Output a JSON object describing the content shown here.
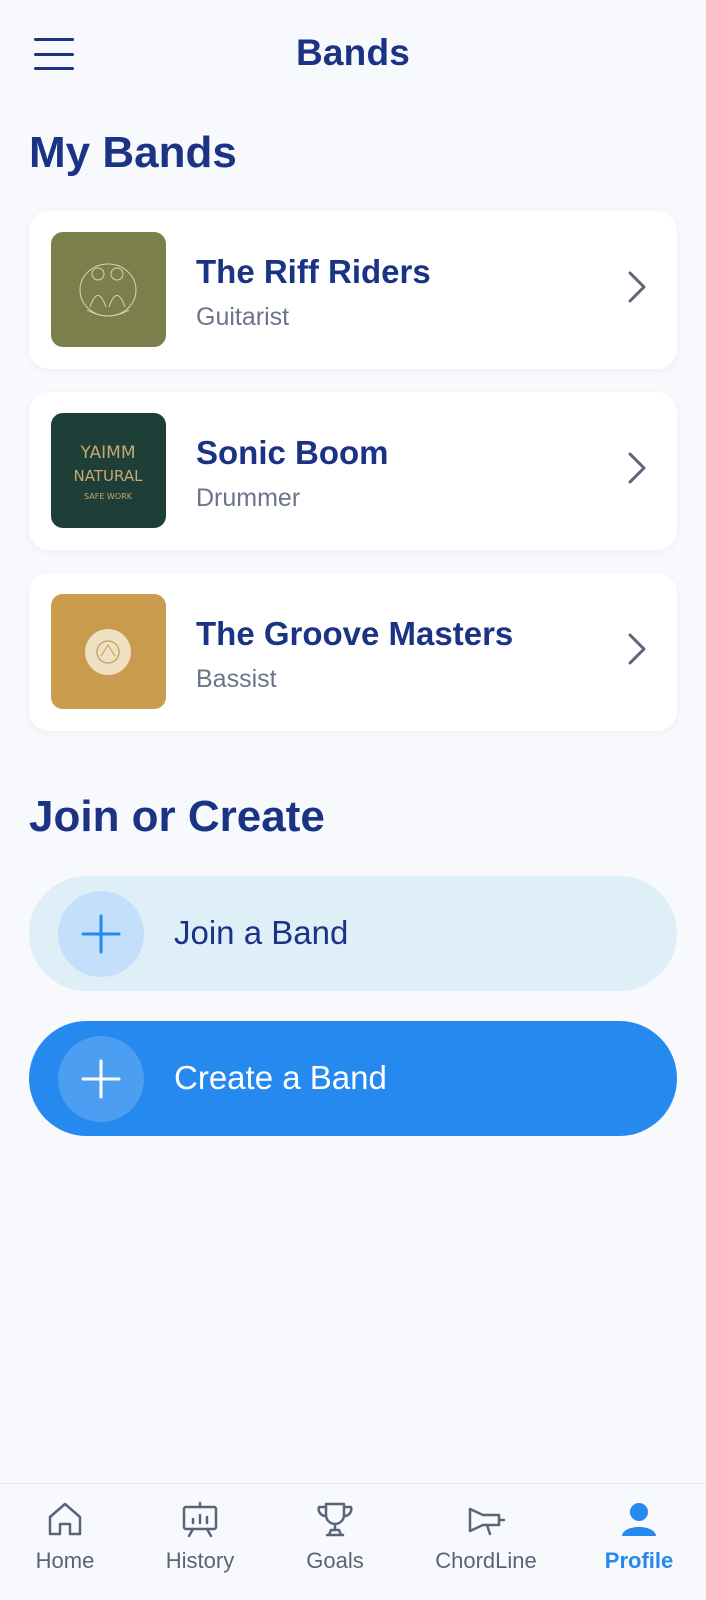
{
  "header": {
    "title": "Bands",
    "menu_icon": "hamburger-menu-icon"
  },
  "my_bands": {
    "heading": "My Bands",
    "items": [
      {
        "name": "The Riff Riders",
        "role": "Guitarist",
        "thumb_color": "#7b7f4b"
      },
      {
        "name": "Sonic Boom",
        "role": "Drummer",
        "thumb_color": "#1d3f38",
        "thumb_text": [
          "YAIMM",
          "NATURAL",
          "SAFE WORK"
        ]
      },
      {
        "name": "The Groove Masters",
        "role": "Bassist",
        "thumb_color": "#c99b4d"
      }
    ]
  },
  "join_create": {
    "heading": "Join or Create",
    "join_label": "Join a Band",
    "create_label": "Create a Band"
  },
  "nav": {
    "items": [
      {
        "label": "Home",
        "icon": "home-icon"
      },
      {
        "label": "History",
        "icon": "history-chart-icon"
      },
      {
        "label": "Goals",
        "icon": "trophy-icon"
      },
      {
        "label": "ChordLine",
        "icon": "megaphone-icon"
      },
      {
        "label": "Profile",
        "icon": "profile-icon",
        "active": true
      }
    ]
  },
  "colors": {
    "primary": "#1b3385",
    "accent": "#2589ef",
    "background": "#f7f9fc"
  }
}
